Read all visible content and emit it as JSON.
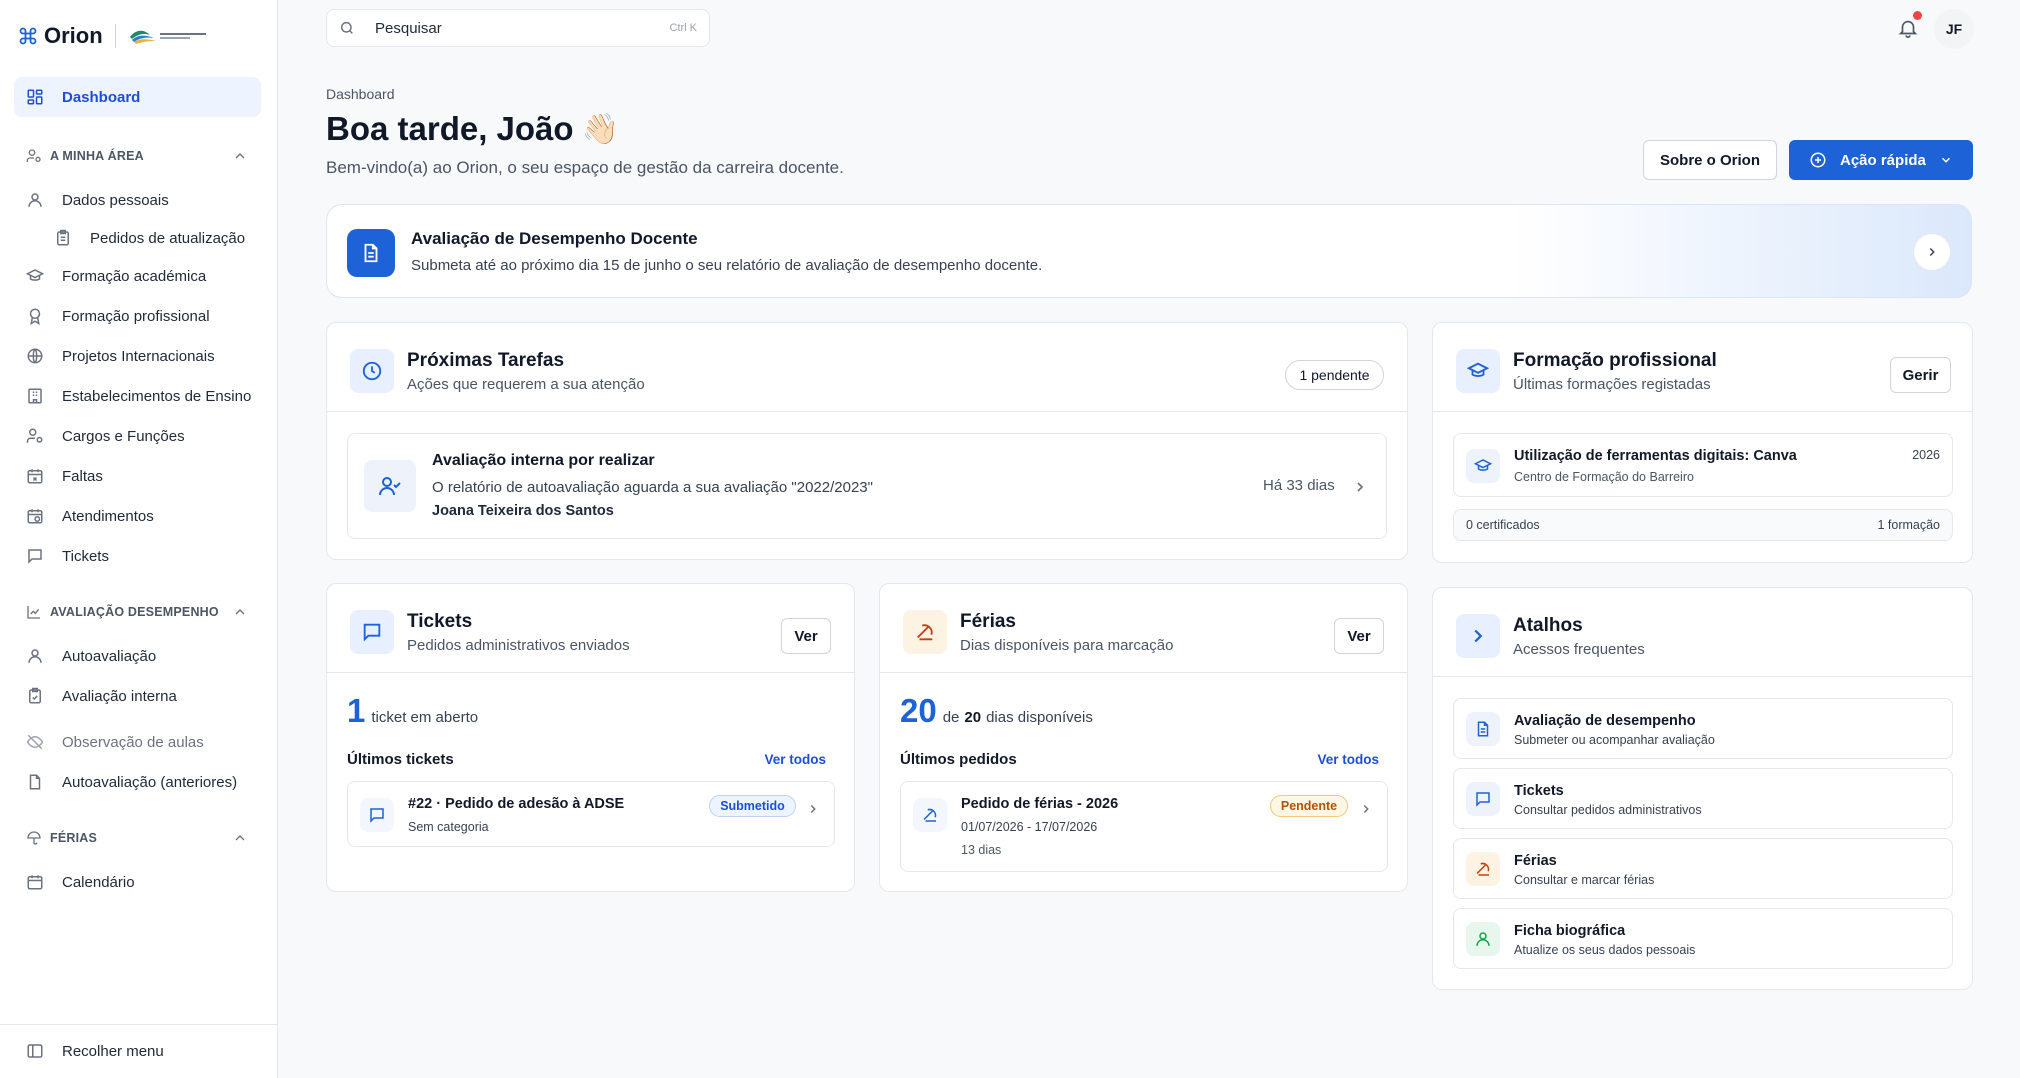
{
  "brand": {
    "name": "Orion"
  },
  "sidebar": {
    "dashboard": "Dashboard",
    "sections": [
      {
        "label": "A MINHA ÁREA"
      },
      {
        "label": "AVALIAÇÃO DESEMPENHO"
      },
      {
        "label": "FÉRIAS"
      }
    ],
    "items": [
      {
        "label": "Dados pessoais"
      },
      {
        "label": "Pedidos de atualização"
      },
      {
        "label": "Formação académica"
      },
      {
        "label": "Formação profissional"
      },
      {
        "label": "Projetos Internacionais"
      },
      {
        "label": "Estabelecimentos de Ensino"
      },
      {
        "label": "Cargos e Funções"
      },
      {
        "label": "Faltas"
      },
      {
        "label": "Atendimentos"
      },
      {
        "label": "Tickets"
      },
      {
        "label": "Autoavaliação"
      },
      {
        "label": "Avaliação interna"
      },
      {
        "label": "Observação de aulas"
      },
      {
        "label": "Autoavaliação (anteriores)"
      },
      {
        "label": "Calendário"
      }
    ],
    "collapse": "Recolher menu"
  },
  "topbar": {
    "search_placeholder": "Pesquisar",
    "shortcut": "Ctrl K",
    "avatar": "JF"
  },
  "header": {
    "breadcrumb": "Dashboard",
    "title": "Boa tarde, João",
    "emoji": "👋🏻",
    "subtitle": "Bem-vindo(a) ao Orion, o seu espaço de gestão da carreira docente.",
    "about_button": "Sobre o Orion",
    "quick_button": "Ação rápida"
  },
  "banner": {
    "title": "Avaliação de Desempenho Docente",
    "text": "Submeta até ao próximo dia 15 de junho o seu relatório de avaliação de desempenho docente."
  },
  "tasks": {
    "title": "Próximas Tarefas",
    "subtitle": "Ações que requerem a sua atenção",
    "pending": "1 pendente",
    "item": {
      "title": "Avaliação interna por realizar",
      "text": "O relatório de autoavaliação aguarda a sua avaliação \"2022/2023\"",
      "person": "Joana Teixeira dos Santos",
      "age": "Há 33 dias"
    }
  },
  "training": {
    "title": "Formação profissional",
    "subtitle": "Últimas formações registadas",
    "manage": "Gerir",
    "item": {
      "title": "Utilização de ferramentas digitais: Canva",
      "org": "Centro de Formação do Barreiro",
      "year": "2026"
    },
    "certificates": "0 certificados",
    "count": "1 formação"
  },
  "tickets": {
    "title": "Tickets",
    "subtitle": "Pedidos administrativos enviados",
    "view": "Ver",
    "open_count": "1",
    "open_label": "ticket em aberto",
    "recent_label": "Últimos tickets",
    "see_all": "Ver todos",
    "item": {
      "title": "#22 · Pedido de adesão à ADSE",
      "category": "Sem categoria",
      "status": "Submetido"
    }
  },
  "vacation": {
    "title": "Férias",
    "subtitle": "Dias disponíveis para marcação",
    "view": "Ver",
    "available": "20",
    "of": "de",
    "total": "20",
    "days_label": "dias disponíveis",
    "recent_label": "Últimos pedidos",
    "see_all": "Ver todos",
    "item": {
      "title": "Pedido de férias - 2026",
      "dates": "01/07/2026 - 17/07/2026",
      "days": "13 dias",
      "status": "Pendente"
    }
  },
  "shortcuts": {
    "title": "Atalhos",
    "subtitle": "Acessos frequentes",
    "items": [
      {
        "title": "Avaliação de desempenho",
        "desc": "Submeter ou acompanhar avaliação"
      },
      {
        "title": "Tickets",
        "desc": "Consultar pedidos administrativos"
      },
      {
        "title": "Férias",
        "desc": "Consultar e marcar férias"
      },
      {
        "title": "Ficha biográfica",
        "desc": "Atualize os seus dados pessoais"
      }
    ]
  },
  "colors": {
    "primary": "#1d62d6",
    "active_bg": "#eef4ff",
    "pending": "#d97706",
    "submitted": "#1d4ed8",
    "notification": "#ef4444"
  }
}
